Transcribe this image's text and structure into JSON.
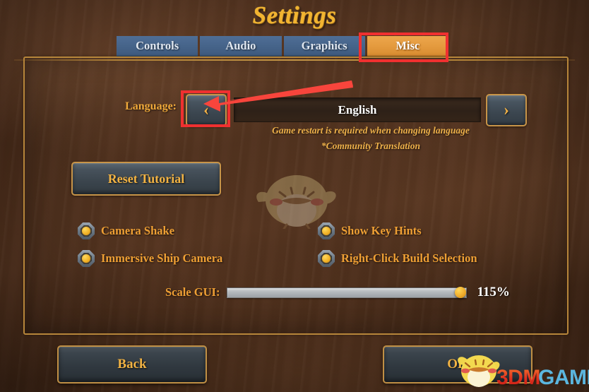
{
  "window": {
    "title": "Settings"
  },
  "tabs": [
    {
      "label": "Controls",
      "active": false
    },
    {
      "label": "Audio",
      "active": false
    },
    {
      "label": "Graphics",
      "active": false
    },
    {
      "label": "Misc",
      "active": true
    }
  ],
  "language": {
    "label": "Language:",
    "value": "English",
    "prev_icon": "chevron-left-icon",
    "next_icon": "chevron-right-icon",
    "prev_glyph": "‹",
    "next_glyph": "›",
    "note_restart": "Game restart is required when changing language",
    "note_community": "*Community Translation"
  },
  "buttons": {
    "reset_tutorial": "Reset Tutorial",
    "back": "Back",
    "ok": "OK"
  },
  "options": [
    {
      "label": "Camera Shake",
      "checked": true
    },
    {
      "label": "Immersive Ship Camera",
      "checked": true
    },
    {
      "label": "Show Key Hints",
      "checked": true
    },
    {
      "label": "Right-Click Build Selection",
      "checked": true
    }
  ],
  "scale_gui": {
    "label": "Scale GUI:",
    "value": "115%",
    "percent": 95
  },
  "watermark": {
    "text_primary": "3DM",
    "text_secondary": "GAME",
    "mascot": "chick-mascot-icon"
  },
  "annotations": [
    {
      "name": "misc-tab-highlight",
      "shape": "rect",
      "color": "#f03030"
    },
    {
      "name": "language-prev-highlight",
      "shape": "rect",
      "color": "#f03030"
    },
    {
      "name": "pointer-arrow",
      "shape": "arrow",
      "color": "#f84a42"
    }
  ],
  "colors": {
    "title_gold": "#f2b430",
    "tab_active": "#e49a3e",
    "tab_inactive": "#46648a",
    "label_orange": "#ee9f34",
    "panel_border": "#b7863a",
    "annotation_red": "#f03030",
    "watermark_red": "#e03a26",
    "watermark_blue": "#5bb6df"
  }
}
